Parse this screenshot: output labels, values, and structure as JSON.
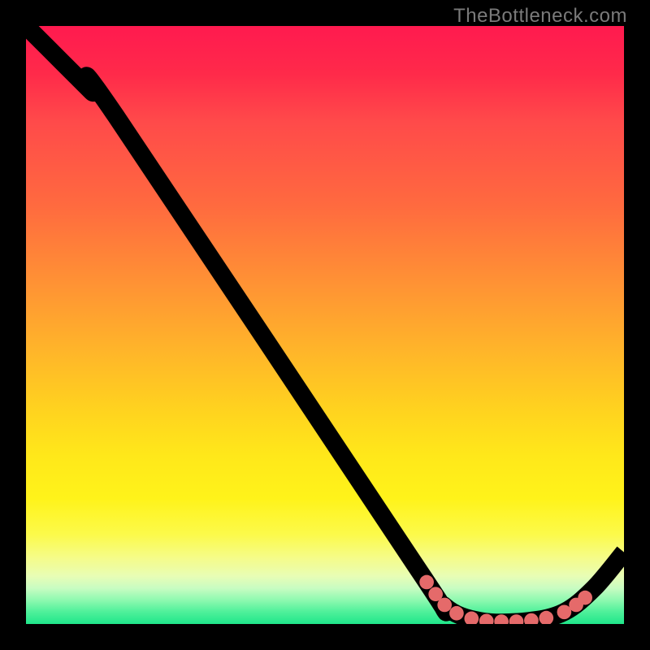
{
  "attribution": "TheBottleneck.com",
  "chart_data": {
    "type": "line",
    "title": "",
    "xlabel": "",
    "ylabel": "",
    "xlim": [
      0,
      100
    ],
    "ylim": [
      0,
      100
    ],
    "series": [
      {
        "name": "curve",
        "points": [
          {
            "x": 0,
            "y": 100
          },
          {
            "x": 6,
            "y": 94
          },
          {
            "x": 11,
            "y": 89
          },
          {
            "x": 15,
            "y": 85
          },
          {
            "x": 65,
            "y": 10
          },
          {
            "x": 70,
            "y": 3
          },
          {
            "x": 76,
            "y": 0.5
          },
          {
            "x": 84,
            "y": 0.5
          },
          {
            "x": 90,
            "y": 2
          },
          {
            "x": 95,
            "y": 6
          },
          {
            "x": 100,
            "y": 12
          }
        ]
      }
    ],
    "markers": [
      {
        "x": 67,
        "y": 7
      },
      {
        "x": 68.5,
        "y": 5
      },
      {
        "x": 70,
        "y": 3.2
      },
      {
        "x": 72,
        "y": 1.8
      },
      {
        "x": 74.5,
        "y": 0.9
      },
      {
        "x": 77,
        "y": 0.5
      },
      {
        "x": 79.5,
        "y": 0.4
      },
      {
        "x": 82,
        "y": 0.4
      },
      {
        "x": 84.5,
        "y": 0.6
      },
      {
        "x": 87,
        "y": 1.0
      },
      {
        "x": 90,
        "y": 2.0
      },
      {
        "x": 92,
        "y": 3.2
      },
      {
        "x": 93.5,
        "y": 4.4
      }
    ],
    "gradient_stops": [
      {
        "pos": 0,
        "color": "#ff1a4f"
      },
      {
        "pos": 50,
        "color": "#ffa82a"
      },
      {
        "pos": 80,
        "color": "#fff31a"
      },
      {
        "pos": 100,
        "color": "#1fe68a"
      }
    ]
  }
}
